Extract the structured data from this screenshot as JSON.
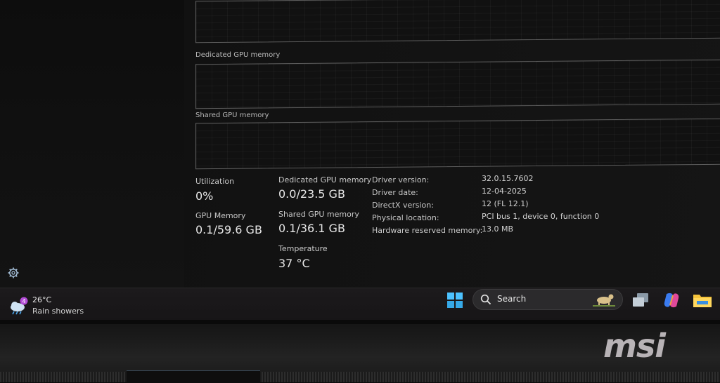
{
  "graphs": {
    "dedicated_label": "Dedicated GPU memory",
    "shared_label": "Shared GPU memory"
  },
  "stats": {
    "utilization_label": "Utilization",
    "utilization_value": "0%",
    "gpu_memory_label": "GPU Memory",
    "gpu_memory_value": "0.1/59.6 GB",
    "dedicated_label": "Dedicated GPU memory",
    "dedicated_value": "0.0/23.5 GB",
    "shared_label": "Shared GPU memory",
    "shared_value": "0.1/36.1 GB",
    "temperature_label": "Temperature",
    "temperature_value": "37 °C"
  },
  "info": [
    {
      "label": "Driver version:",
      "value": "32.0.15.7602"
    },
    {
      "label": "Driver date:",
      "value": "12-04-2025"
    },
    {
      "label": "DirectX version:",
      "value": "12 (FL 12.1)"
    },
    {
      "label": "Physical location:",
      "value": "PCI bus 1, device 0, function 0"
    },
    {
      "label": "Hardware reserved memory:",
      "value": "13.0 MB"
    }
  ],
  "taskbar": {
    "weather_temp": "26°C",
    "weather_condition": "Rain showers",
    "weather_badge": "4",
    "search_label": "Search"
  },
  "brand": {
    "logo_text": "msi"
  },
  "colors": {
    "background": "#111111",
    "graph_border": "#5d5d5d",
    "taskbar": "#1c1a1c",
    "start_blue": "#4cc2ff",
    "folder_yellow": "#f5c33b"
  },
  "icons": [
    "settings-icon",
    "weather-icon",
    "windows-start-icon",
    "search-icon",
    "task-view-icon",
    "copilot-icon",
    "file-explorer-icon"
  ]
}
